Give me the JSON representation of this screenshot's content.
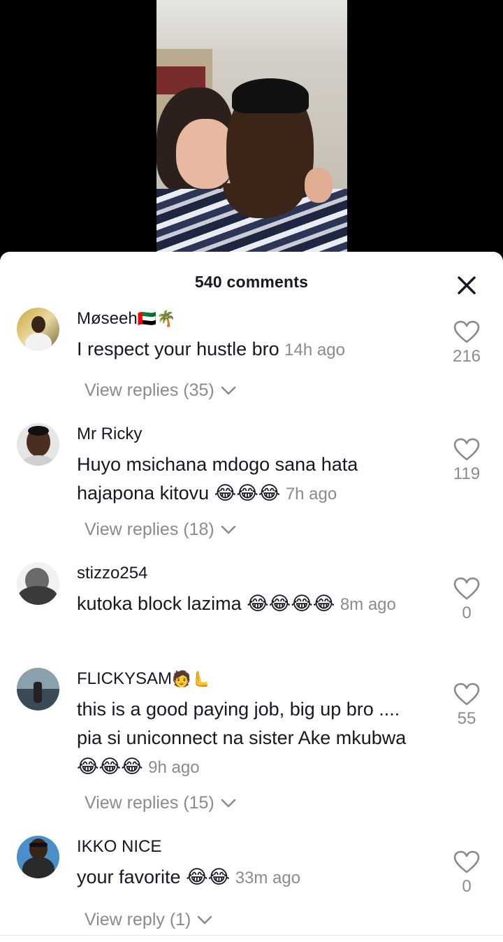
{
  "header": {
    "comment_count_label": "540 comments"
  },
  "icons": {
    "close": "close-icon",
    "like": "heart-outline-icon",
    "expand": "chevron-down-icon"
  },
  "colors": {
    "text": "#161823",
    "secondary": "#8a8b91",
    "sheet": "#ffffff"
  },
  "comments": [
    {
      "username": "Møseeh",
      "username_emoji": "🇦🇪🌴",
      "text": "I respect your hustle bro",
      "time": "14h ago",
      "likes": "216",
      "replies_label": "View replies (35)"
    },
    {
      "username": "Mr Ricky",
      "username_emoji": "",
      "text": "Huyo msichana mdogo sana hata hajapona kitovu 😂😂😂",
      "time": "7h ago",
      "likes": "119",
      "replies_label": "View replies (18)"
    },
    {
      "username": "stizzo254",
      "username_emoji": "",
      "text": "kutoka block lazima 😂😂😂😂",
      "time": "8m ago",
      "likes": "0",
      "replies_label": ""
    },
    {
      "username": "FLICKYSAM",
      "username_emoji": "🧑🫷",
      "text": "this is a good paying job, big up bro .... pia si uniconnect na sister Ake mkubwa😂😂😂",
      "time": "9h ago",
      "likes": "55",
      "replies_label": "View replies (15)"
    },
    {
      "username": "IKKO NICE",
      "username_emoji": "",
      "text": "your favorite 😂😂",
      "time": "33m ago",
      "likes": "0",
      "replies_label": "View reply (1)"
    }
  ]
}
